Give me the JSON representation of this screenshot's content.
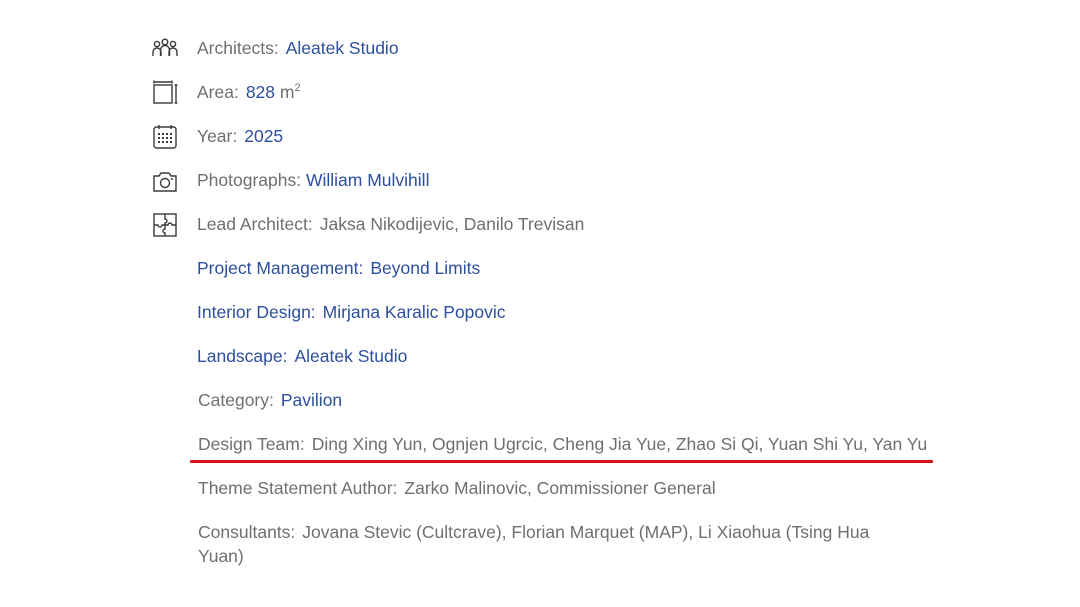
{
  "details": {
    "architects": {
      "label": "Architects:",
      "value": "Aleatek Studio",
      "icon": "people-icon"
    },
    "area": {
      "label": "Area:",
      "value": "828",
      "unit": "m",
      "unit_sup": "2",
      "icon": "area-icon"
    },
    "year": {
      "label": "Year:",
      "value": "2025",
      "icon": "calendar-icon"
    },
    "photographs": {
      "label": "Photographs:",
      "value": "William Mulvihill",
      "icon": "camera-icon"
    },
    "lead_architect": {
      "label": "Lead Architect:",
      "value": "Jaksa Nikodijevic, Danilo Trevisan",
      "icon": "puzzle-icon"
    },
    "project_management": {
      "label": "Project Management:",
      "value": "Beyond Limits"
    },
    "interior_design": {
      "label": "Interior Design:",
      "value": "Mirjana Karalic Popovic"
    },
    "landscape": {
      "label": "Landscape:",
      "value": "Aleatek Studio"
    },
    "category": {
      "label": "Category:",
      "value": "Pavilion"
    },
    "design_team": {
      "label": "Design Team:",
      "value": "Ding Xing Yun, Ognjen Ugrcic, Cheng Jia Yue, Zhao Si Qi, Yuan Shi Yu, Yan Yu"
    },
    "theme_statement_author": {
      "label": "Theme Statement Author:",
      "value": "Zarko Malinovic, Commissioner General"
    },
    "consultants": {
      "label": "Consultants:",
      "value": "Jovana Stevic (Cultcrave), Florian Marquet (MAP), Li Xiaohua (Tsing Hua Yuan)"
    }
  },
  "colors": {
    "link": "#2c4f9e",
    "text": "#6f6f6f",
    "highlight_underline": "#d9121a"
  }
}
